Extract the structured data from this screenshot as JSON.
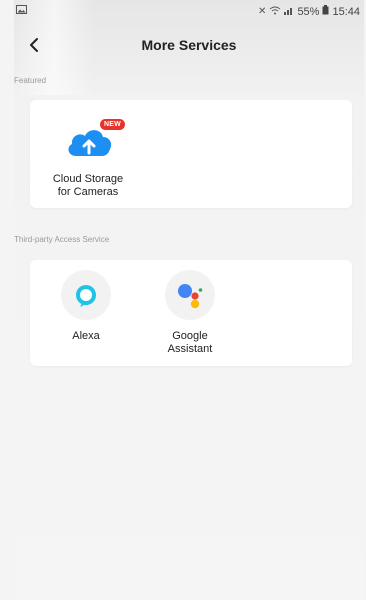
{
  "status_bar": {
    "icons": [
      "image-icon",
      "mute-icon",
      "wifi-icon",
      "signal-icon"
    ],
    "battery": "55%",
    "time": "15:44"
  },
  "header": {
    "back_icon": "chevron-left-icon",
    "title": "More Services"
  },
  "featured": {
    "section_label": "Featured",
    "items": [
      {
        "label_line1": "Cloud Storage",
        "label_line2": "for Cameras",
        "badge": "NEW",
        "icon": "cloud-upload-icon"
      }
    ]
  },
  "third_party": {
    "section_label": "Third-party Access Service",
    "items": [
      {
        "label": "Alexa",
        "icon": "alexa-icon"
      },
      {
        "label_line1": "Google",
        "label_line2": "Assistant",
        "icon": "google-assistant-icon"
      }
    ]
  },
  "colors": {
    "accent_blue": "#1e8ff2",
    "badge_red": "#e8332b",
    "alexa_cyan": "#1ec3e6"
  }
}
